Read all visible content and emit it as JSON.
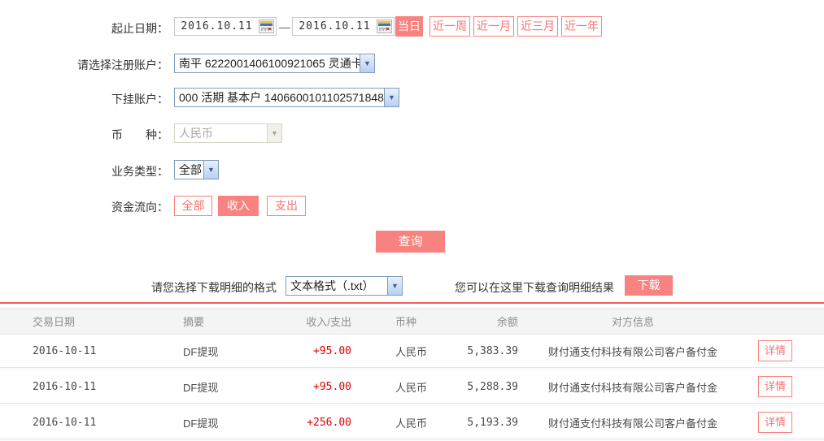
{
  "colors": {
    "accent": "#f8827f",
    "amount_red": "#dd0000",
    "table_rule_red": "#f25c5a"
  },
  "form": {
    "date_range": {
      "label": "起止日期：",
      "start": "2016.10.11",
      "end": "2016.10.11",
      "separator": "—",
      "quick_buttons": [
        {
          "label": "当日",
          "active": true
        },
        {
          "label": "近一周",
          "active": false
        },
        {
          "label": "近一月",
          "active": false
        },
        {
          "label": "近三月",
          "active": false
        },
        {
          "label": "近一年",
          "active": false
        }
      ]
    },
    "register_account": {
      "label": "请选择注册账户：",
      "value": "南平 6222001406100921065 灵通卡"
    },
    "sub_account": {
      "label": "下挂账户：",
      "value": "000 活期 基本户 1406600101102571848"
    },
    "currency": {
      "label": "币　　种：",
      "value": "人民币",
      "disabled": true
    },
    "business_type": {
      "label": "业务类型：",
      "value": "全部"
    },
    "fund_flow": {
      "label": "资金流向：",
      "options": [
        {
          "label": "全部",
          "active": false
        },
        {
          "label": "收入",
          "active": true
        },
        {
          "label": "支出",
          "active": false
        }
      ]
    },
    "query_button": "查询"
  },
  "download": {
    "format_label": "请您选择下载明细的格式",
    "format_value": "文本格式（.txt）",
    "hint": "您可以在这里下载查询明细结果",
    "button": "下载"
  },
  "table": {
    "headers": [
      "交易日期",
      "摘要",
      "收入/支出",
      "币种",
      "余额",
      "对方信息"
    ],
    "detail_label": "详情",
    "rows": [
      {
        "date": "2016-10-11",
        "summary": "DF提现",
        "amount": "+95.00",
        "currency": "人民币",
        "balance": "5,383.39",
        "counterparty": "财付通支付科技有限公司客户备付金"
      },
      {
        "date": "2016-10-11",
        "summary": "DF提现",
        "amount": "+95.00",
        "currency": "人民币",
        "balance": "5,288.39",
        "counterparty": "财付通支付科技有限公司客户备付金"
      },
      {
        "date": "2016-10-11",
        "summary": "DF提现",
        "amount": "+256.00",
        "currency": "人民币",
        "balance": "5,193.39",
        "counterparty": "财付通支付科技有限公司客户备付金"
      }
    ]
  }
}
